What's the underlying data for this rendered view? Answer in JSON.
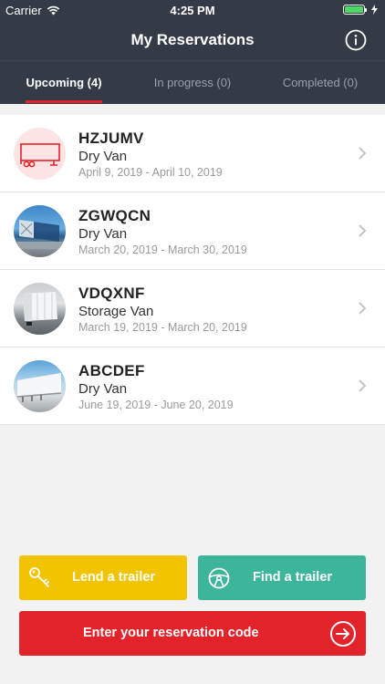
{
  "status_bar": {
    "carrier": "Carrier",
    "time": "4:25 PM"
  },
  "header": {
    "title": "My Reservations",
    "info_icon": "info-icon"
  },
  "tabs": [
    {
      "label": "Upcoming (4)",
      "active": true
    },
    {
      "label": "In progress (0)",
      "active": false
    },
    {
      "label": "Completed (0)",
      "active": false
    }
  ],
  "reservations": [
    {
      "code": "HZJUMV",
      "type": "Dry Van",
      "dates": "April 9, 2019 - April 10, 2019",
      "thumbnail": "trailer-icon"
    },
    {
      "code": "ZGWQCN",
      "type": "Dry Van",
      "dates": "March 20, 2019 - March 30, 2019",
      "thumbnail": "trailer-photo"
    },
    {
      "code": "VDQXNF",
      "type": "Storage Van",
      "dates": "March 19, 2019 - March 20, 2019",
      "thumbnail": "trailer-photo"
    },
    {
      "code": "ABCDEF",
      "type": "Dry Van",
      "dates": "June 19, 2019 - June 20, 2019",
      "thumbnail": "trailer-photo"
    }
  ],
  "actions": {
    "lend_label": "Lend a trailer",
    "find_label": "Find a trailer",
    "code_label": "Enter your reservation code"
  },
  "colors": {
    "header_bg": "#343a46",
    "accent_red": "#e3232a",
    "lend_yellow": "#f2c400",
    "find_green": "#3db59a"
  }
}
